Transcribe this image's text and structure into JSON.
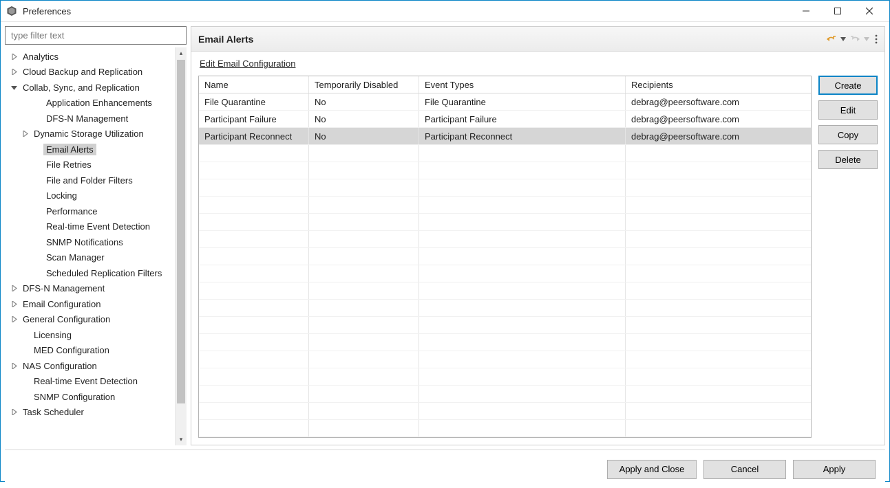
{
  "window": {
    "title": "Preferences"
  },
  "filter": {
    "placeholder": "type filter text"
  },
  "tree": {
    "items": [
      {
        "label": "Analytics",
        "indent": 0,
        "twisty": "collapsed"
      },
      {
        "label": "Cloud Backup and Replication",
        "indent": 0,
        "twisty": "collapsed"
      },
      {
        "label": "Collab, Sync, and Replication",
        "indent": 0,
        "twisty": "expanded"
      },
      {
        "label": "Application Enhancements",
        "indent": 2,
        "twisty": "none"
      },
      {
        "label": "DFS-N Management",
        "indent": 2,
        "twisty": "none"
      },
      {
        "label": "Dynamic Storage Utilization",
        "indent": 1,
        "twisty": "collapsed"
      },
      {
        "label": "Email Alerts",
        "indent": 2,
        "twisty": "none",
        "selected": true
      },
      {
        "label": "File Retries",
        "indent": 2,
        "twisty": "none"
      },
      {
        "label": "File and Folder Filters",
        "indent": 2,
        "twisty": "none"
      },
      {
        "label": "Locking",
        "indent": 2,
        "twisty": "none"
      },
      {
        "label": "Performance",
        "indent": 2,
        "twisty": "none"
      },
      {
        "label": "Real-time Event Detection",
        "indent": 2,
        "twisty": "none"
      },
      {
        "label": "SNMP Notifications",
        "indent": 2,
        "twisty": "none"
      },
      {
        "label": "Scan Manager",
        "indent": 2,
        "twisty": "none"
      },
      {
        "label": "Scheduled Replication Filters",
        "indent": 2,
        "twisty": "none"
      },
      {
        "label": "DFS-N Management",
        "indent": 0,
        "twisty": "collapsed"
      },
      {
        "label": "Email Configuration",
        "indent": 0,
        "twisty": "collapsed"
      },
      {
        "label": "General Configuration",
        "indent": 0,
        "twisty": "collapsed"
      },
      {
        "label": "Licensing",
        "indent": 1,
        "twisty": "none"
      },
      {
        "label": "MED Configuration",
        "indent": 1,
        "twisty": "none"
      },
      {
        "label": "NAS Configuration",
        "indent": 0,
        "twisty": "collapsed"
      },
      {
        "label": "Real-time Event Detection",
        "indent": 1,
        "twisty": "none"
      },
      {
        "label": "SNMP Configuration",
        "indent": 1,
        "twisty": "none"
      },
      {
        "label": "Task Scheduler",
        "indent": 0,
        "twisty": "collapsed"
      }
    ]
  },
  "panel": {
    "title": "Email Alerts",
    "link": "Edit Email Configuration"
  },
  "table": {
    "headers": {
      "name": "Name",
      "disabled": "Temporarily Disabled",
      "events": "Event Types",
      "recipients": "Recipients"
    },
    "rows": [
      {
        "name": "File Quarantine",
        "disabled": "No",
        "events": "File Quarantine",
        "recipients": "debrag@peersoftware.com"
      },
      {
        "name": "Participant Failure",
        "disabled": "No",
        "events": "Participant Failure",
        "recipients": "debrag@peersoftware.com"
      },
      {
        "name": "Participant Reconnect",
        "disabled": "No",
        "events": "Participant Reconnect",
        "recipients": "debrag@peersoftware.com",
        "selected": true
      }
    ]
  },
  "buttons": {
    "create": "Create",
    "edit": "Edit",
    "copy": "Copy",
    "delete": "Delete",
    "apply_close": "Apply and Close",
    "cancel": "Cancel",
    "apply": "Apply"
  }
}
